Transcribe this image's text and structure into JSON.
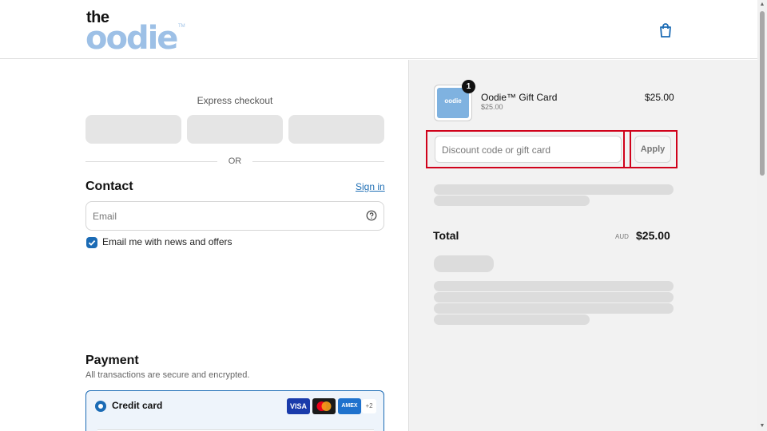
{
  "header": {
    "logo_top": "the",
    "logo_word": "oodie",
    "logo_tm": "TM",
    "cart_icon": "shopping-bag-icon"
  },
  "express": {
    "label": "Express checkout",
    "or": "OR"
  },
  "contact": {
    "title": "Contact",
    "sign_in": "Sign in",
    "email_placeholder": "Email",
    "help_icon": "question-circle-icon",
    "newsletter_label": "Email me with news and offers",
    "newsletter_checked": true
  },
  "payment": {
    "title": "Payment",
    "subtitle": "All transactions are secure and encrypted.",
    "method_label": "Credit card",
    "brands": [
      "VISA",
      "",
      "AMEX"
    ],
    "more_brands": "+2"
  },
  "summary": {
    "quantity_badge": "1",
    "product_name": "Oodie™ Gift Card",
    "product_sub": "$25.00",
    "product_price": "$25.00",
    "thumb_text": "oodie",
    "discount_placeholder": "Discount code or gift card",
    "apply_label": "Apply",
    "total_label": "Total",
    "total_currency": "AUD",
    "total_value": "$25.00"
  },
  "colors": {
    "accent": "#1b6bb5",
    "highlight": "#d0021b",
    "brand_blue": "#9dc0e6"
  }
}
